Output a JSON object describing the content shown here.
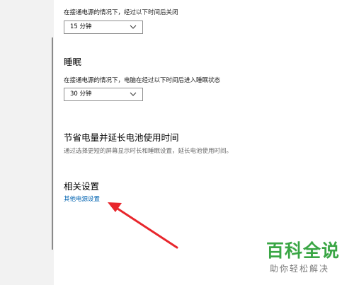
{
  "screen_timeout": {
    "description": "在接通电源的情况下，经过以下时间后关闭",
    "selected": "15 分钟"
  },
  "sleep": {
    "title": "睡眠",
    "description": "在接通电源的情况下，电脑在经过以下时间后进入睡眠状态",
    "selected": "30 分钟"
  },
  "battery": {
    "title": "节省电量并延长电池使用时间",
    "description": "通过选择更短的屏幕显示时长和睡眠设置，延长电池使用时间。"
  },
  "related": {
    "title": "相关设置",
    "link": "其他电源设置"
  },
  "annotation": {
    "color": "#e8262c"
  },
  "watermark": {
    "main": "百科全说",
    "sub": "助你轻松解决",
    "color": "#3aa645"
  }
}
